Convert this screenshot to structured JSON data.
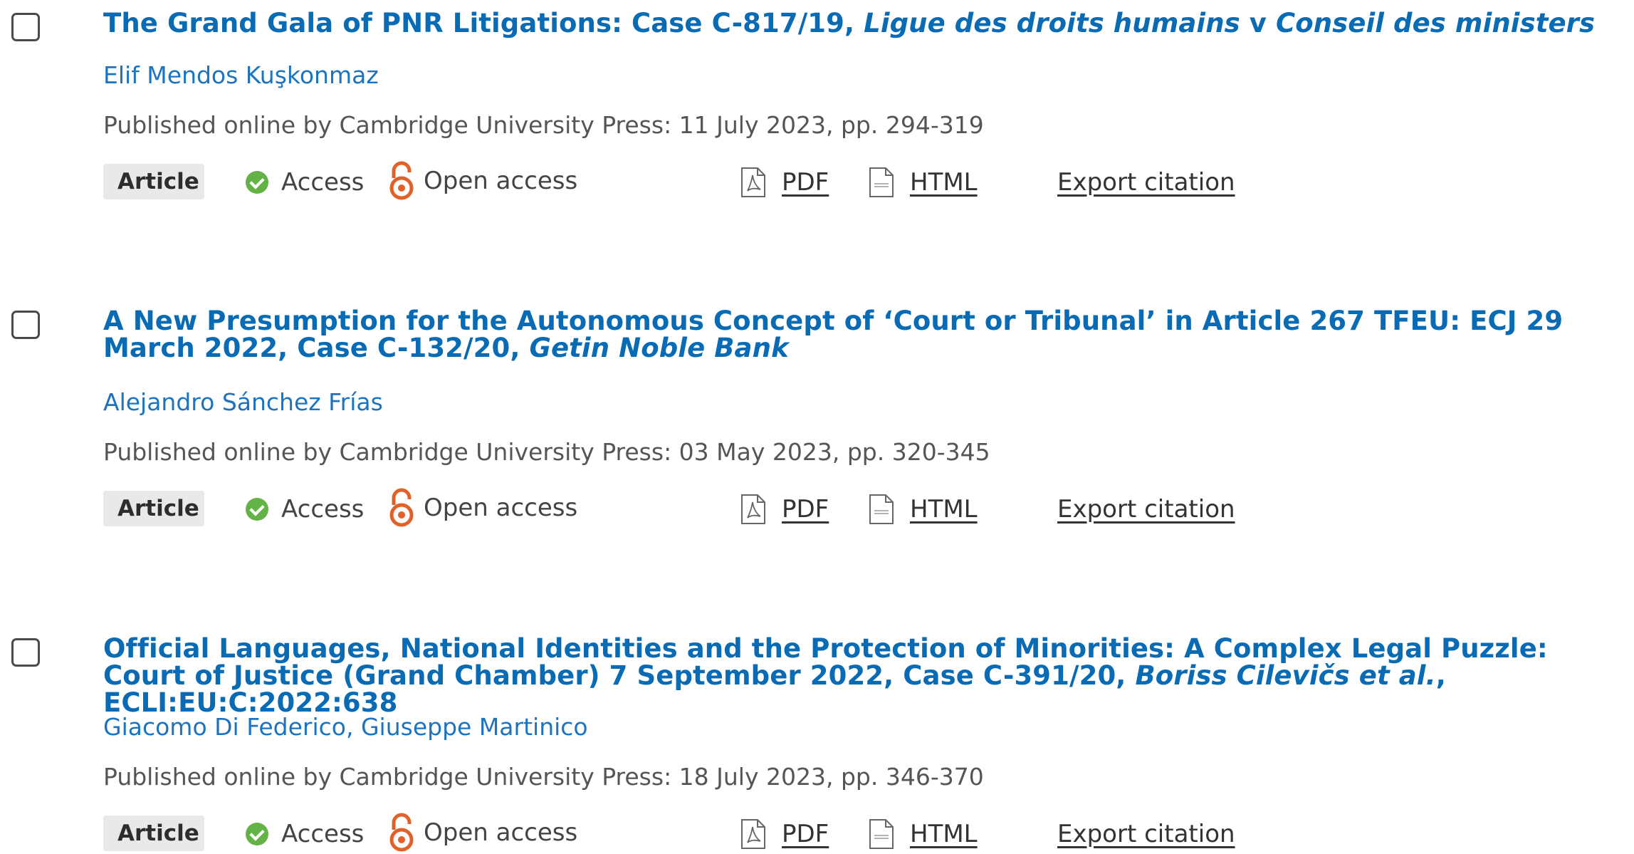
{
  "results": [
    {
      "title_plain": "The Grand Gala of PNR Litigations: Case C-817/19, ",
      "title_italic": "Ligue des droits humains",
      "title_mid": " v ",
      "title_italic2": "Conseil des ministers",
      "title_tail": "",
      "authors": [
        "Elif Mendos Kuşkonmaz"
      ],
      "published": "Published online by Cambridge University Press: 11 July 2023, pp. 294-319",
      "type": "Article",
      "access": "Access",
      "open_access": "Open access",
      "pdf": "PDF",
      "html": "HTML",
      "export": "Export citation"
    },
    {
      "title_plain": "A New Presumption for the Autonomous Concept of ‘Court or Tribunal’ in Article 267 TFEU: ECJ 29 March 2022, Case C-132/20, ",
      "title_italic": "Getin Noble Bank",
      "title_mid": "",
      "title_italic2": "",
      "title_tail": "",
      "authors": [
        "Alejandro Sánchez Frías"
      ],
      "published": "Published online by Cambridge University Press: 03 May 2023, pp. 320-345",
      "type": "Article",
      "access": "Access",
      "open_access": "Open access",
      "pdf": "PDF",
      "html": "HTML",
      "export": "Export citation"
    },
    {
      "title_plain": "Official Languages, National Identities and the Protection of Minorities: A Complex Legal Puzzle: Court of Justice (Grand Chamber) 7 September 2022, Case C-391/20, ",
      "title_italic": "Boriss Cilevičs et al.",
      "title_mid": "",
      "title_italic2": "",
      "title_tail": ", ECLI:EU:C:2022:638",
      "authors": [
        "Giacomo Di Federico",
        "Giuseppe Martinico"
      ],
      "author_sep": ", ",
      "published": "Published online by Cambridge University Press: 18 July 2023, pp. 346-370",
      "type": "Article",
      "access": "Access",
      "open_access": "Open access",
      "pdf": "PDF",
      "html": "HTML",
      "export": "Export citation"
    }
  ],
  "colors": {
    "title": "#0a6bb5",
    "author": "#1e73be",
    "access_check": "#62b246",
    "open_access_icon": "#e0622a"
  },
  "icons": [
    "checkbox",
    "check-circle-icon",
    "open-access-lock-icon",
    "pdf-file-icon",
    "html-file-icon"
  ]
}
